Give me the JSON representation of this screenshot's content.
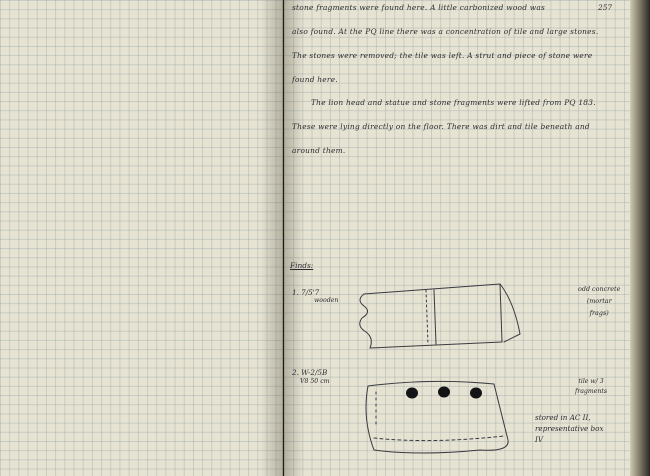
{
  "notebook": {
    "page_number": "257",
    "paragraph_lines": [
      "stone fragments were found here. A little carbonized wood was",
      "also found. At the PQ line there was a concentration of tile and large stones.",
      "The stones were removed; the tile was left. A strut and piece of stone were",
      "found here.",
      "The lion head and statue and stone fragments were lifted from PQ 183.",
      "These were lying directly on the floor. There was dirt and tile beneath and",
      "around them."
    ],
    "finds": {
      "heading": "Finds:",
      "items": [
        {
          "number": "1. 7/5'7",
          "detail": "wooden",
          "note_lines": [
            "odd concrete",
            "(mortar",
            "frags)"
          ]
        },
        {
          "number": "2. W-2/5B",
          "detail": "V8 50 cm",
          "note_lines": [
            "tile w/ 3",
            "fragments"
          ]
        }
      ],
      "storage_note_lines": [
        "stored in AC II,",
        "representative box",
        "IV"
      ]
    }
  }
}
